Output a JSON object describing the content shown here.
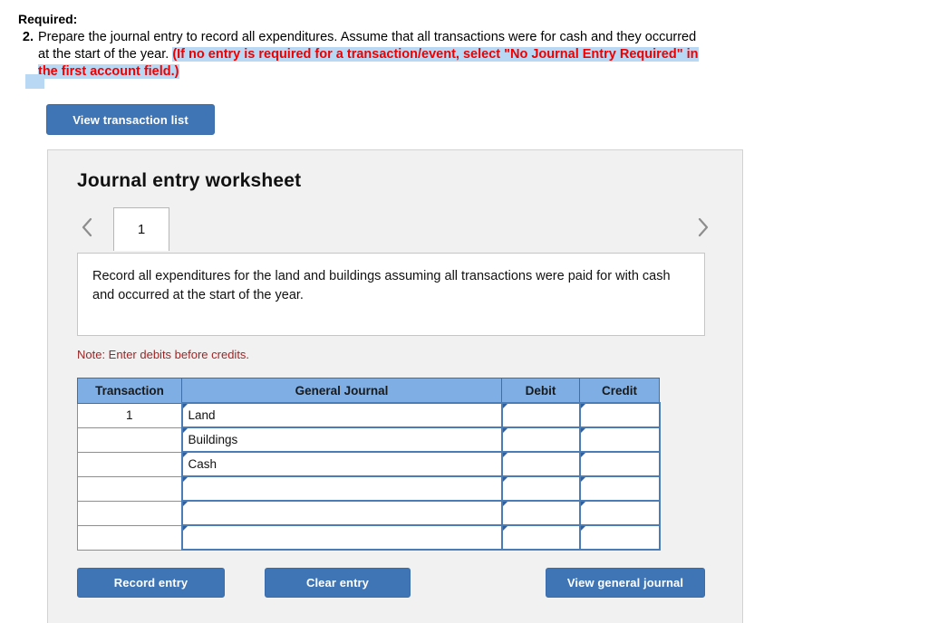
{
  "required": {
    "label": "Required:",
    "number": "2.",
    "text_before": "Prepare the journal entry to record all expenditures. Assume that all transactions were for cash and they occurred at the start of the year. ",
    "parenthetical": "(If no entry is required for a transaction/event, select \"No Journal Entry Required\" in the first account field.)"
  },
  "toolbar": {
    "view_transaction_list_label": "View transaction list"
  },
  "worksheet": {
    "title": "Journal entry worksheet",
    "prev_icon": "chevron-left-icon",
    "next_icon": "chevron-right-icon",
    "tabs": [
      {
        "label": "1",
        "active": true
      }
    ],
    "instruction": "Record all expenditures for the land and buildings assuming all transactions were paid for with cash and occurred at the start of the year.",
    "note": "Note: Enter debits before credits.",
    "table": {
      "columns": [
        "Transaction",
        "General Journal",
        "Debit",
        "Credit"
      ],
      "rows": [
        {
          "transaction": "1",
          "general_journal": "Land",
          "debit": "",
          "credit": ""
        },
        {
          "transaction": "",
          "general_journal": "Buildings",
          "debit": "",
          "credit": ""
        },
        {
          "transaction": "",
          "general_journal": "Cash",
          "debit": "",
          "credit": ""
        },
        {
          "transaction": "",
          "general_journal": "",
          "debit": "",
          "credit": ""
        },
        {
          "transaction": "",
          "general_journal": "",
          "debit": "",
          "credit": ""
        },
        {
          "transaction": "",
          "general_journal": "",
          "debit": "",
          "credit": ""
        }
      ]
    },
    "actions": {
      "record_entry_label": "Record entry",
      "clear_entry_label": "Clear entry",
      "view_general_journal_label": "View general journal"
    }
  },
  "colors": {
    "button_blue": "#3f75b5",
    "table_header_blue": "#7eaee3",
    "cell_border_blue": "#4a7cb5",
    "highlight_blue": "#b9d8f4",
    "note_red": "#9e2525",
    "parenthetical_red": "#ee0000",
    "panel_gray": "#f1f1f1"
  }
}
